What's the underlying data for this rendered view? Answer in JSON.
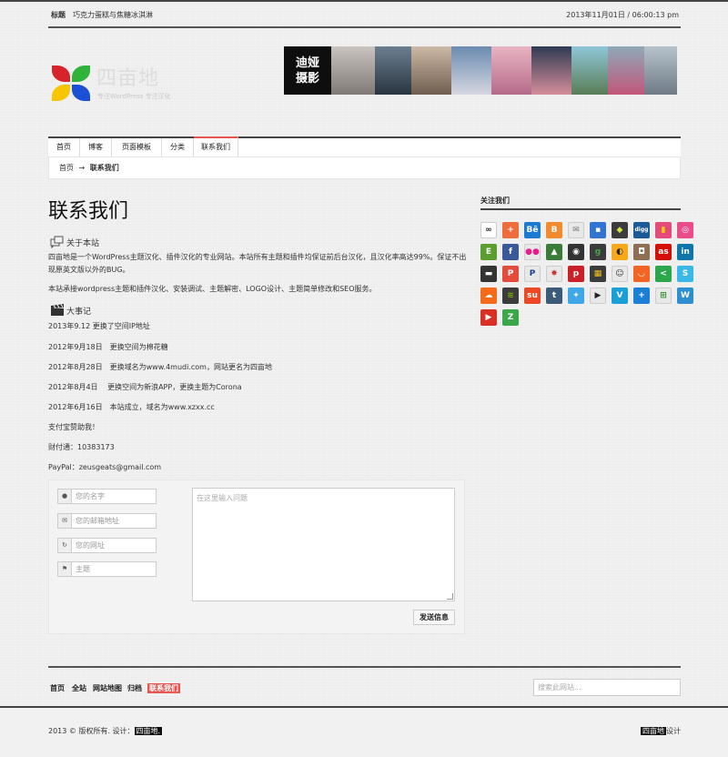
{
  "topbar": {
    "label": "标题",
    "title": "巧克力蛋糕与焦糖冰淇淋",
    "datetime": "2013年11月01日 / 06:00:13 pm"
  },
  "logo": {
    "name": "四亩地",
    "tagline": "专注WordPress 专注汉化",
    "colors": [
      "#d8232a",
      "#2fb33a",
      "#f7c600",
      "#1a4fd6"
    ]
  },
  "banner": {
    "brand": "迪娅 摄影",
    "brand_line1": "迪娅",
    "brand_line2": "摄影"
  },
  "nav": {
    "items": [
      "首页",
      "博客",
      "页面模板",
      "分类",
      "联系我们"
    ],
    "active": "联系我们",
    "accent": "#e8554e"
  },
  "breadcrumb": {
    "home": "首页",
    "arrow": "→",
    "current": "联系我们"
  },
  "main": {
    "title": "联系我们",
    "about_head": "关于本站",
    "about_p1": "四亩地是一个WordPress主题汉化、插件汉化的专业网站。本站所有主题和插件均保证前后台汉化，且汉化率高达99%。保证不出现原英文版以外的BUG。",
    "about_p2": "本站承接wordpress主题和插件汉化、安装调试、主题解密、LOGO设计、主题简单修改和SEO服务。",
    "events_head": "大事记",
    "events": [
      "2013年9.12 更换了空间IP地址",
      "2012年9月18日　更换空间为棉花糖",
      "2012年8月28日　更换域名为www.4mudi.com，网站更名为四亩地",
      "2012年8月4日　 更换空间为新浪APP，更换主题为Corona",
      "2012年6月16日　本站成立，域名为www.xzxx.cc"
    ],
    "donate": "支付宝赞助我！",
    "tenpay": "财付通：10383173",
    "paypal": "PayPal：zeusgeats@gmail.com"
  },
  "form": {
    "name_placeholder": "您的名字",
    "email_placeholder": "您的邮箱地址",
    "url_placeholder": "您的网址",
    "subject_placeholder": "主题",
    "message_placeholder": "在这里输入问题",
    "send_label": "发送信息"
  },
  "sidebar": {
    "title": "关注我们",
    "icons": [
      {
        "name": "infinity-icon",
        "glyph": "∞",
        "color": "#ffffff",
        "fg": "#222"
      },
      {
        "name": "google-plus-icon",
        "glyph": "+",
        "color": "#ef6d3d",
        "fg": "#fff"
      },
      {
        "name": "behance-icon",
        "glyph": "Bē",
        "color": "#1d7ad2",
        "fg": "#fff"
      },
      {
        "name": "blogger-icon",
        "glyph": "B",
        "color": "#f28a2e",
        "fg": "#fff"
      },
      {
        "name": "mail-icon",
        "glyph": "✉",
        "color": "#e8e8e8",
        "fg": "#777"
      },
      {
        "name": "delicious-icon",
        "glyph": "▪",
        "color": "#3274d2",
        "fg": "#fff"
      },
      {
        "name": "designmoo-icon",
        "glyph": "◆",
        "color": "#3c3c3c",
        "fg": "#d8e04a"
      },
      {
        "name": "digg-icon",
        "glyph": "digg",
        "color": "#1b5a96",
        "fg": "#fff"
      },
      {
        "name": "colour-lovers-icon",
        "glyph": "▮",
        "color": "#e34b7a",
        "fg": "#ffd400"
      },
      {
        "name": "dribbble-icon",
        "glyph": "◎",
        "color": "#ea4c89",
        "fg": "#fff"
      },
      {
        "name": "evernote-icon",
        "glyph": "E",
        "color": "#5b9e2f",
        "fg": "#fff"
      },
      {
        "name": "facebook-icon",
        "glyph": "f",
        "color": "#3b5998",
        "fg": "#fff"
      },
      {
        "name": "flickr-icon",
        "glyph": "●●",
        "color": "#e8e8e8",
        "fg": "#e1208e"
      },
      {
        "name": "forrst-icon",
        "glyph": "▲",
        "color": "#3a7b3a",
        "fg": "#fff"
      },
      {
        "name": "github-icon",
        "glyph": "◉",
        "color": "#333333",
        "fg": "#fff"
      },
      {
        "name": "google-icon",
        "glyph": "g",
        "color": "#3c3c3c",
        "fg": "#4ba34b"
      },
      {
        "name": "grooveshark-icon",
        "glyph": "◐",
        "color": "#f7a91b",
        "fg": "#222"
      },
      {
        "name": "instagram-icon",
        "glyph": "◘",
        "color": "#8e6f53",
        "fg": "#fff"
      },
      {
        "name": "lastfm-icon",
        "glyph": "as",
        "color": "#d51007",
        "fg": "#fff"
      },
      {
        "name": "linkedin-icon",
        "glyph": "in",
        "color": "#0e76a8",
        "fg": "#fff"
      },
      {
        "name": "myspace-icon",
        "glyph": "▬",
        "color": "#333333",
        "fg": "#fff"
      },
      {
        "name": "pinterest-p-icon",
        "glyph": "P",
        "color": "#e34b3c",
        "fg": "#fff"
      },
      {
        "name": "paypal-icon",
        "glyph": "P",
        "color": "#e8e8e8",
        "fg": "#1b3f88"
      },
      {
        "name": "picasa-icon",
        "glyph": "✸",
        "color": "#e8e8e8",
        "fg": "#c33"
      },
      {
        "name": "pinterest-icon",
        "glyph": "p",
        "color": "#cb2027",
        "fg": "#fff"
      },
      {
        "name": "qik-icon",
        "glyph": "▦",
        "color": "#3c3c3c",
        "fg": "#f2c21a"
      },
      {
        "name": "reddit-icon",
        "glyph": "☺",
        "color": "#e8e8e8",
        "fg": "#333"
      },
      {
        "name": "rss-icon",
        "glyph": "◡",
        "color": "#f26522",
        "fg": "#fff"
      },
      {
        "name": "share-icon",
        "glyph": "<",
        "color": "#2aa84a",
        "fg": "#fff"
      },
      {
        "name": "skype-icon",
        "glyph": "S",
        "color": "#3ab8e8",
        "fg": "#fff"
      },
      {
        "name": "soundcloud-icon",
        "glyph": "☁",
        "color": "#f56b1a",
        "fg": "#fff"
      },
      {
        "name": "spotify-icon",
        "glyph": "≋",
        "color": "#3c3c3c",
        "fg": "#7ab800"
      },
      {
        "name": "stumbleupon-icon",
        "glyph": "su",
        "color": "#eb4823",
        "fg": "#fff"
      },
      {
        "name": "tumblr-icon",
        "glyph": "t",
        "color": "#3c5a7a",
        "fg": "#fff"
      },
      {
        "name": "twitter-icon",
        "glyph": "✦",
        "color": "#3fa7e8",
        "fg": "#fff"
      },
      {
        "name": "vimeo-icon",
        "glyph": "▶",
        "color": "#e8e8e8",
        "fg": "#222"
      },
      {
        "name": "vine-icon",
        "glyph": "V",
        "color": "#1a9fd6",
        "fg": "#fff"
      },
      {
        "name": "plus-icon",
        "glyph": "+",
        "color": "#1c7fd6",
        "fg": "#fff"
      },
      {
        "name": "windows-icon",
        "glyph": "⊞",
        "color": "#e8e8e8",
        "fg": "#2a8c2a"
      },
      {
        "name": "wordpress-icon",
        "glyph": "W",
        "color": "#2e8fd0",
        "fg": "#fff"
      },
      {
        "name": "youtube-icon",
        "glyph": "▶",
        "color": "#d92f24",
        "fg": "#fff"
      },
      {
        "name": "zerply-icon",
        "glyph": "Z",
        "color": "#3aa84a",
        "fg": "#fff"
      }
    ]
  },
  "footer": {
    "nav": [
      "首页",
      "全站",
      "网站地图",
      "归档",
      "联系我们"
    ],
    "active": "联系我们",
    "search_placeholder": "搜索此网站...",
    "copyright": "2013 © 版权所有. 设计：",
    "copyright_tag": "四亩地.",
    "credit_tag": "四亩地",
    "credit_text": "设计"
  }
}
